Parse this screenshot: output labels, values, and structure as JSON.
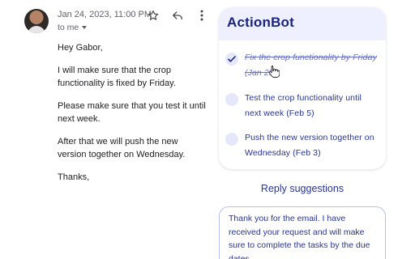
{
  "email": {
    "date": "Jan 24, 2023, 11:00 PM",
    "recipient": "to me",
    "icons": {
      "avatar": "sender-avatar",
      "star": "star-icon",
      "reply": "reply-icon",
      "more": "more-vertical-icon"
    },
    "body": [
      "Hey Gabor,",
      "I will make sure that the crop functionality is fixed by Friday.",
      "Please make sure that you test it until next week.",
      "After that we will push the new version together on Wednesday.",
      "Thanks,"
    ]
  },
  "actionbot": {
    "title": "ActionBot",
    "tasks": [
      {
        "label": "Fix the crop functionality by Friday (Jan 29)",
        "completed": true
      },
      {
        "label": "Test the crop functionality until next week (Feb 5)",
        "completed": false
      },
      {
        "label": "Push the new version together on Wednesday (Feb 3)",
        "completed": false
      }
    ]
  },
  "replies": {
    "heading": "Reply suggestions",
    "suggestions": [
      "Thank you for the email. I have received your request and will make sure to complete the tasks by the due dates."
    ]
  },
  "colors": {
    "accent": "#1a237e",
    "task_text": "#283593",
    "card_header_bg": "#eef0ff",
    "check_bg": "#e5e8fb"
  }
}
